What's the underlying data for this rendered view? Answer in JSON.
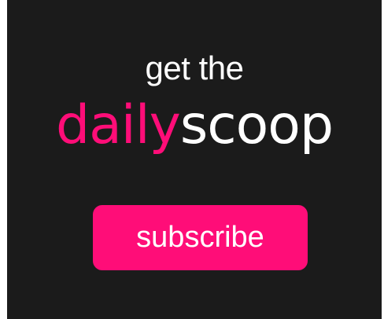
{
  "ad": {
    "eyebrow": "get the",
    "brand_part1": "daily",
    "brand_part2": "scoop",
    "cta_label": "subscribe"
  },
  "colors": {
    "background": "#1b1b1b",
    "accent_pink": "#ff0d78",
    "text_white": "#ffffff"
  }
}
